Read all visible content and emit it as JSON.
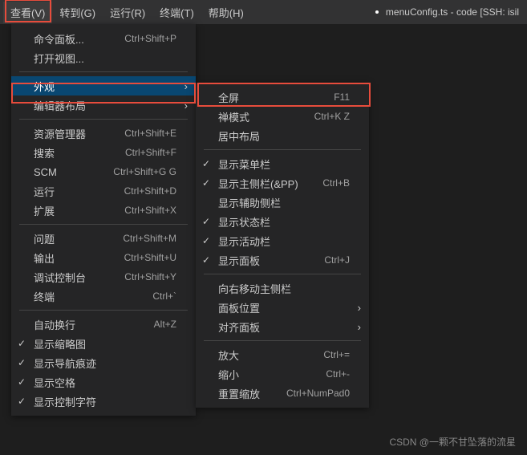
{
  "menubar": {
    "view": "查看(V)",
    "goto": "转到(G)",
    "run": "运行(R)",
    "terminal": "终端(T)",
    "help": "帮助(H)"
  },
  "titleText": "menuConfig.ts - code [SSH: isil",
  "viewMenu": {
    "commandPalette": "命令面板...",
    "commandPaletteKey": "Ctrl+Shift+P",
    "openView": "打开视图...",
    "appearance": "外观",
    "editorLayout": "编辑器布局",
    "explorer": "资源管理器",
    "explorerKey": "Ctrl+Shift+E",
    "search": "搜索",
    "searchKey": "Ctrl+Shift+F",
    "scm": "SCM",
    "scmKey": "Ctrl+Shift+G G",
    "run": "运行",
    "runKey": "Ctrl+Shift+D",
    "extensions": "扩展",
    "extensionsKey": "Ctrl+Shift+X",
    "problems": "问题",
    "problemsKey": "Ctrl+Shift+M",
    "output": "输出",
    "outputKey": "Ctrl+Shift+U",
    "debugConsole": "调试控制台",
    "debugConsoleKey": "Ctrl+Shift+Y",
    "terminal": "终端",
    "terminalKey": "Ctrl+`",
    "wordWrap": "自动换行",
    "wordWrapKey": "Alt+Z",
    "minimap": "显示缩略图",
    "breadcrumbs": "显示导航痕迹",
    "whitespace": "显示空格",
    "controlChars": "显示控制字符"
  },
  "appearanceMenu": {
    "fullscreen": "全屏",
    "fullscreenKey": "F11",
    "zenMode": "禅模式",
    "zenModeKey": "Ctrl+K Z",
    "centeredLayout": "居中布局",
    "menuBar": "显示菜单栏",
    "primarySideBar": "显示主侧栏(&PP)",
    "primarySideBarKey": "Ctrl+B",
    "secondarySideBar": "显示辅助侧栏",
    "statusBar": "显示状态栏",
    "activityBar": "显示活动栏",
    "panel": "显示面板",
    "panelKey": "Ctrl+J",
    "moveSideBarRight": "向右移动主侧栏",
    "panelPosition": "面板位置",
    "alignPanel": "对齐面板",
    "zoomIn": "放大",
    "zoomInKey": "Ctrl+=",
    "zoomOut": "缩小",
    "zoomOutKey": "Ctrl+-",
    "resetZoom": "重置缩放",
    "resetZoomKey": "Ctrl+NumPad0"
  },
  "watermark": "CSDN @一颗不甘坠落的流星"
}
